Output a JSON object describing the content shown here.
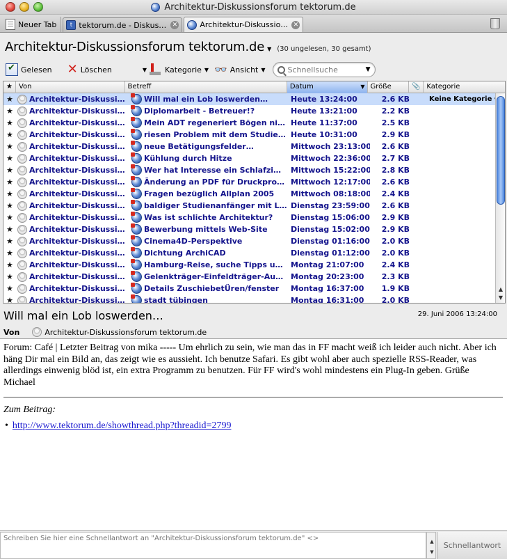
{
  "window": {
    "title": "Architektur-Diskussionsforum tektorum.de"
  },
  "tabs": {
    "new_tab_label": "Neuer Tab",
    "items": [
      {
        "label": "tektorum.de - Diskuss…",
        "icon": "forum-icon"
      },
      {
        "label": "Architektur-Diskussio…",
        "icon": "rss-icon",
        "active": true
      }
    ]
  },
  "header": {
    "title": "Architektur-Diskussionsforum tektorum.de",
    "count": "(30 ungelesen, 30 gesamt)"
  },
  "toolbar": {
    "read_label": "Gelesen",
    "delete_label": "Löschen",
    "category_label": "Kategorie",
    "view_label": "Ansicht",
    "search_placeholder": "Schnellsuche"
  },
  "columns": {
    "from": "Von",
    "subject": "Betreff",
    "date": "Datum",
    "size": "Größe",
    "category": "Kategorie"
  },
  "rows": [
    {
      "from": "Architektur-Diskussio…",
      "subject": "Will mal ein Lob loswerden…",
      "date": "Heute 13:24:00",
      "size": "2.6 KB",
      "category": "Keine Kategorie"
    },
    {
      "from": "Architektur-Diskussio…",
      "subject": "Diplomarbeit - Betreuer!?",
      "date": "Heute 13:21:00",
      "size": "2.2 KB",
      "category": ""
    },
    {
      "from": "Architektur-Diskussio…",
      "subject": "Mein ADT regeneriert Bögen nicht!",
      "date": "Heute 11:37:00",
      "size": "2.5 KB",
      "category": ""
    },
    {
      "from": "Architektur-Diskussio…",
      "subject": "riesen Problem mit dem Studienbe…",
      "date": "Heute 10:31:00",
      "size": "2.9 KB",
      "category": ""
    },
    {
      "from": "Architektur-Diskussio…",
      "subject": "neue Betätigungsfelder…",
      "date": "Mittwoch 23:13:00",
      "size": "2.6 KB",
      "category": ""
    },
    {
      "from": "Architektur-Diskussio…",
      "subject": "Kühlung durch Hitze",
      "date": "Mittwoch 22:36:00",
      "size": "2.7 KB",
      "category": ""
    },
    {
      "from": "Architektur-Diskussio…",
      "subject": "Wer hat Interesse ein Schlafzimme…",
      "date": "Mittwoch 15:22:00",
      "size": "2.8 KB",
      "category": ""
    },
    {
      "from": "Architektur-Diskussio…",
      "subject": "Änderung an PDF für Druckprodu…",
      "date": "Mittwoch 12:17:00",
      "size": "2.6 KB",
      "category": ""
    },
    {
      "from": "Architektur-Diskussio…",
      "subject": "Fragen bezüglich Allplan 2005",
      "date": "Mittwoch 08:18:00",
      "size": "2.4 KB",
      "category": ""
    },
    {
      "from": "Architektur-Diskussio…",
      "subject": "baldiger Studienanfänger mit Lang…",
      "date": "Dienstag 23:59:00",
      "size": "2.6 KB",
      "category": ""
    },
    {
      "from": "Architektur-Diskussio…",
      "subject": "Was ist schlichte Architektur?",
      "date": "Dienstag 15:06:00",
      "size": "2.9 KB",
      "category": ""
    },
    {
      "from": "Architektur-Diskussio…",
      "subject": "Bewerbung mittels Web-Site",
      "date": "Dienstag 15:02:00",
      "size": "2.9 KB",
      "category": ""
    },
    {
      "from": "Architektur-Diskussio…",
      "subject": "Cinema4D-Perspektive",
      "date": "Dienstag 01:16:00",
      "size": "2.0 KB",
      "category": ""
    },
    {
      "from": "Architektur-Diskussio…",
      "subject": "Dichtung ArchiCAD",
      "date": "Dienstag 01:12:00",
      "size": "2.0 KB",
      "category": ""
    },
    {
      "from": "Architektur-Diskussio…",
      "subject": "Hamburg-Reise, suche Tipps und …",
      "date": "Montag 21:07:00",
      "size": "2.4 KB",
      "category": ""
    },
    {
      "from": "Architektur-Diskussio…",
      "subject": "Gelenkträger-Einfeldträger-Auflag…",
      "date": "Montag 20:23:00",
      "size": "2.3 KB",
      "category": ""
    },
    {
      "from": "Architektur-Diskussio…",
      "subject": "Details ZuschiebetÜren/fenster",
      "date": "Montag 16:37:00",
      "size": "1.9 KB",
      "category": ""
    },
    {
      "from": "Architektur-Diskussio…",
      "subject": "stadt tübingen",
      "date": "Montag 16:31:00",
      "size": "2.0 KB",
      "category": ""
    }
  ],
  "message": {
    "subject": "Will mal ein Lob loswerden…",
    "date": "29. Juni 2006 13:24:00",
    "from_label": "Von",
    "from": "Architektur-Diskussionsforum tektorum.de",
    "body": "Forum: Café | Letzter Beitrag von mika ----- Um ehrlich zu sein, wie man das in FF macht weiß ich leider auch nicht. Aber ich häng Dir mal ein Bild an, das zeigt wie es aussieht. Ich benutze Safari. Es gibt wohl aber auch spezielle RSS-Reader, was allerdings einwenig blöd ist, ein extra Programm zu benutzen. Für FF wird's wohl mindestens ein Plug-In geben. Grüße Michael",
    "link_heading": "Zum Beitrag:",
    "link": "http://www.tektorum.de/showthread.php?threadid=2799"
  },
  "reply": {
    "placeholder": "Schreiben Sie hier eine Schnellantwort an \"Architektur-Diskussionsforum tektorum.de\" <>",
    "button": "Schnellantwort"
  }
}
